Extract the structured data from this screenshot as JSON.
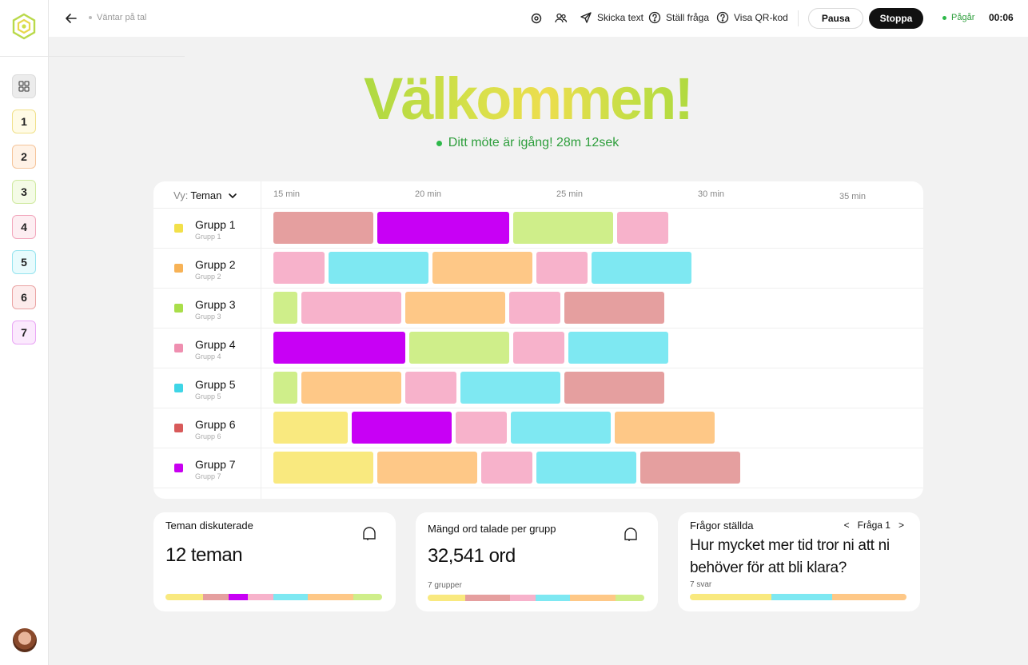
{
  "sidebar": {
    "items": [
      {
        "label": "1",
        "bg": "#fffbe6",
        "border": "#f0e08a"
      },
      {
        "label": "2",
        "bg": "#fff2e6",
        "border": "#f5c49a"
      },
      {
        "label": "3",
        "bg": "#f4fbe6",
        "border": "#cfe9a0"
      },
      {
        "label": "4",
        "bg": "#fdeef2",
        "border": "#f2a6bc"
      },
      {
        "label": "5",
        "bg": "#e8fbfd",
        "border": "#96e4ef"
      },
      {
        "label": "6",
        "bg": "#fdecec",
        "border": "#eaa3a3"
      },
      {
        "label": "7",
        "bg": "#fbe9fd",
        "border": "#e9a6f5"
      }
    ]
  },
  "topbar": {
    "status_text": "Väntar på tal",
    "send_text": "Skicka text",
    "ask_question": "Ställ fråga",
    "show_qr": "Visa QR-kod",
    "pause": "Pausa",
    "stop": "Stoppa",
    "running": "Pågår",
    "timer": "00:06"
  },
  "hero": {
    "title": "Välkommen!",
    "subtitle": "Ditt möte är igång! 28m 12sek"
  },
  "timeline": {
    "view_label": "Vy:",
    "view_value": "Teman",
    "ticks": [
      "15 min",
      "20 min",
      "25 min",
      "30 min",
      "35 min"
    ],
    "groups": [
      {
        "name": "Grupp 1",
        "sub": "Grupp 1",
        "color": "#f2e04a"
      },
      {
        "name": "Grupp 2",
        "sub": "Grupp 2",
        "color": "#f7b256"
      },
      {
        "name": "Grupp 3",
        "sub": "Grupp 3",
        "color": "#a9de4a"
      },
      {
        "name": "Grupp 4",
        "sub": "Grupp 4",
        "color": "#ef8fb0"
      },
      {
        "name": "Grupp 5",
        "sub": "Grupp 5",
        "color": "#3fd5e6"
      },
      {
        "name": "Grupp 6",
        "sub": "Grupp 6",
        "color": "#d85a5a"
      },
      {
        "name": "Grupp 7",
        "sub": "Grupp 7",
        "color": "#c800f0"
      }
    ]
  },
  "cards": {
    "themes": {
      "title": "Teman diskuterade",
      "value": "12 teman"
    },
    "words": {
      "title": "Mängd ord talade per grupp",
      "value": "32,541 ord",
      "sub": "7 grupper"
    },
    "questions": {
      "title": "Frågor ställda",
      "prev": "<",
      "current": "Fråga 1",
      "next": ">",
      "question": "Hur mycket mer tid tror ni att ni behöver för att bli klara?",
      "sub": "7 svar"
    }
  }
}
